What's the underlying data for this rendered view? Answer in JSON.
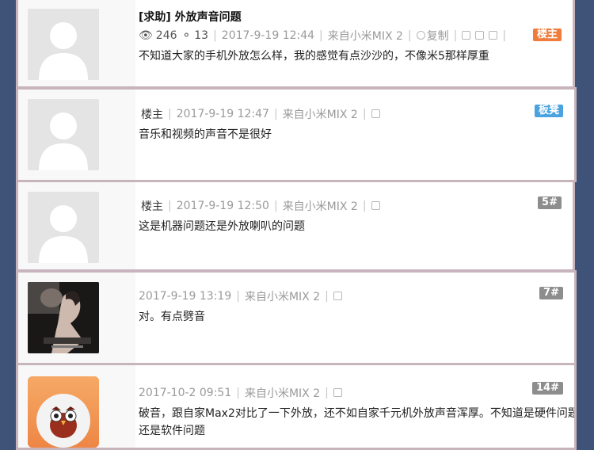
{
  "posts": [
    {
      "title": "[求助] 外放声音问题",
      "views": "246",
      "replies": "13",
      "time": "2017-9-19 12:44",
      "device": "来自小米MIX 2",
      "copy_label": "复制",
      "badge": "楼主",
      "content": "不知道大家的手机外放怎么样，我的感觉有点沙沙的，不像米5那样厚重"
    },
    {
      "author": "楼主",
      "time": "2017-9-19 12:47",
      "device": "来自小米MIX 2",
      "badge": "板凳",
      "content": "音乐和视频的声音不是很好"
    },
    {
      "author": "楼主",
      "time": "2017-9-19 12:50",
      "device": "来自小米MIX 2",
      "badge": "5#",
      "content": "这是机器问题还是外放喇叭的问题"
    },
    {
      "time": "2017-9-19 13:19",
      "device": "来自小米MIX 2",
      "badge": "7#",
      "content": "对。有点劈音"
    },
    {
      "time": "2017-10-2 09:51",
      "device": "来自小米MIX 2",
      "badge": "14#",
      "content": "破音，跟自家Max2对比了一下外放，还不如自家千元机外放声音浑厚。不知道是硬件问题还是软件问题"
    }
  ],
  "colors": {
    "background": "#3f5379",
    "owner_badge": "#f07c3b",
    "featured_badge": "#4aa3df",
    "floor_badge": "#8d8d8d"
  }
}
